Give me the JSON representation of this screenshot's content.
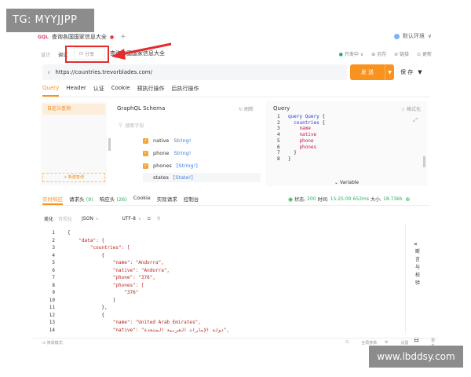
{
  "watermarks": {
    "top_left": "TG: MYYJJPP",
    "bottom_right": "www.lbddsy.com"
  },
  "tabbar": {
    "badge": "GQL",
    "tab_title": "查询各国国家信息大全",
    "add_label": "+",
    "env_label": "默认环境",
    "env_caret": "∨"
  },
  "toolbar": {
    "design": "设计",
    "debug": "调试",
    "share": "分享",
    "doc_title": "查询各国国家信息大全",
    "status": "开发中",
    "save_as": "另存",
    "check": "链接",
    "more": "更新"
  },
  "request": {
    "method_caret": "∨",
    "url": "https://countries.trevorblades.com/",
    "send_label": "发 送",
    "save_label": "保 存"
  },
  "request_tabs": [
    "Query",
    "Header",
    "认证",
    "Cookie",
    "预执行操作",
    "后执行操作"
  ],
  "left_panel": {
    "custom_query": "自定义查询",
    "new_query": "+ 新建查询"
  },
  "schema": {
    "title": "GraphQL Schema",
    "refresh": "刷新",
    "search_placeholder": "搜索字段",
    "fields": [
      {
        "name": "native",
        "type": "String!"
      },
      {
        "name": "phone",
        "type": "String!"
      },
      {
        "name": "phones",
        "type": "[String!]"
      },
      {
        "name": "states",
        "type": "[State!]"
      }
    ]
  },
  "query_panel": {
    "title": "Query",
    "format": "格式化",
    "lines": [
      {
        "n": "1",
        "text": "query Query {"
      },
      {
        "n": "2",
        "text": "  countries {"
      },
      {
        "n": "3",
        "text": "    name"
      },
      {
        "n": "4",
        "text": "    native"
      },
      {
        "n": "5",
        "text": "    phone"
      },
      {
        "n": "6",
        "text": "    phones"
      },
      {
        "n": "7",
        "text": "  }"
      },
      {
        "n": "8",
        "text": "}"
      }
    ],
    "variable_label": "Variable"
  },
  "response_tabs": [
    {
      "label": "实时响应",
      "count": ""
    },
    {
      "label": "请求头",
      "count": "(9)"
    },
    {
      "label": "响应头",
      "count": "(26)"
    },
    {
      "label": "Cookie",
      "count": ""
    },
    {
      "label": "实际请求",
      "count": ""
    },
    {
      "label": "控制台",
      "count": ""
    }
  ],
  "status": {
    "label": "状态:",
    "code": "200",
    "ok": "时间:",
    "time": "15:25:00",
    "duration": "652ms",
    "size_label": "大小:",
    "size": "18.73kb"
  },
  "format_row": {
    "beautify": "美化",
    "visual": "可视化",
    "json": "JSON",
    "utf": "UTF-8"
  },
  "response_lines": [
    {
      "n": "1",
      "text": "{"
    },
    {
      "n": "2",
      "text": "    \"data\": {"
    },
    {
      "n": "3",
      "text": "        \"countries\": ["
    },
    {
      "n": "4",
      "text": "            {"
    },
    {
      "n": "5",
      "text": "                \"name\": \"Andorra\","
    },
    {
      "n": "6",
      "text": "                \"native\": \"Andorra\","
    },
    {
      "n": "7",
      "text": "                \"phone\": \"376\","
    },
    {
      "n": "8",
      "text": "                \"phones\": ["
    },
    {
      "n": "9",
      "text": "                    \"376\""
    },
    {
      "n": "10",
      "text": "                ]"
    },
    {
      "n": "11",
      "text": "            },"
    },
    {
      "n": "12",
      "text": "            {"
    },
    {
      "n": "13",
      "text": "                \"name\": \"United Arab Emirates\","
    },
    {
      "n": "14",
      "text": "                \"native\": \"دولة الإمارات العربية المتحدة\","
    }
  ],
  "side_panel": {
    "text": "断言与校验"
  },
  "bottom_bar": {
    "left": "简易模式",
    "mid": "全局参数",
    "settings": "设置",
    "more": "更多"
  }
}
